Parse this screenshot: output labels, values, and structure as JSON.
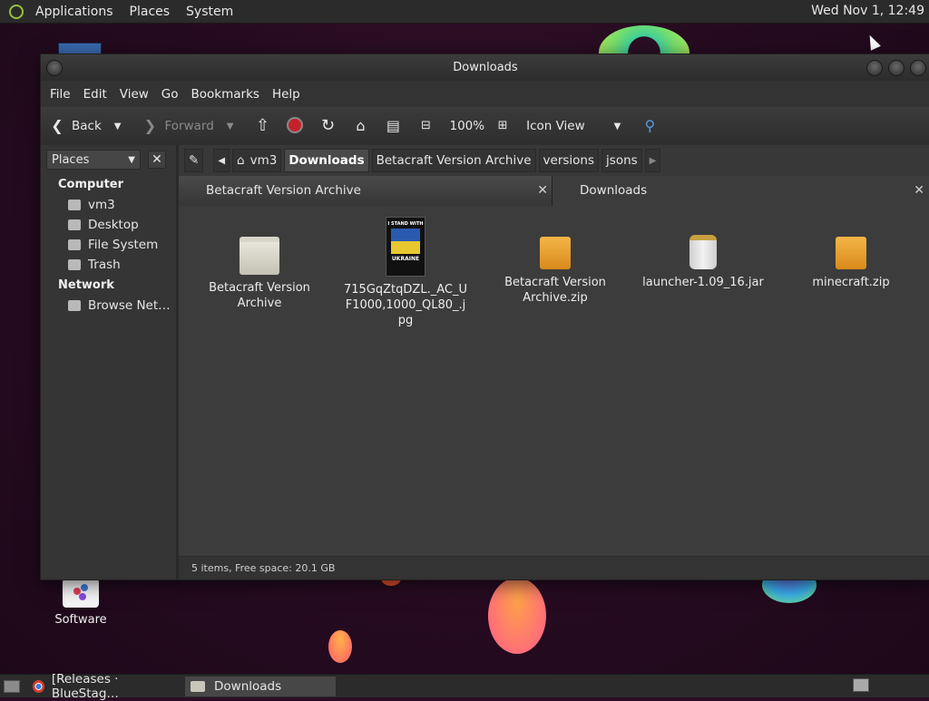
{
  "top_panel": {
    "menus": [
      "Applications",
      "Places",
      "System"
    ],
    "clock": "Wed Nov 1, 12:49"
  },
  "desktop": {
    "software_label": "Software"
  },
  "window": {
    "title": "Downloads",
    "menubar": [
      "File",
      "Edit",
      "View",
      "Go",
      "Bookmarks",
      "Help"
    ],
    "toolbar": {
      "back": "Back",
      "forward": "Forward",
      "zoom": "100%",
      "view_mode": "Icon View"
    },
    "sidebar": {
      "selector": "Places",
      "groups": [
        {
          "title": "Computer",
          "items": [
            "vm3",
            "Desktop",
            "File System",
            "Trash"
          ]
        },
        {
          "title": "Network",
          "items": [
            "Browse Net…"
          ]
        }
      ]
    },
    "pathbar": [
      "vm3",
      "Downloads",
      "Betacraft Version Archive",
      "versions",
      "jsons"
    ],
    "tabs": [
      {
        "label": "Betacraft Version Archive"
      },
      {
        "label": "Downloads"
      }
    ],
    "files": [
      {
        "name": "Betacraft Version Archive",
        "type": "folder"
      },
      {
        "name": "715GqZtqDZL._AC_UF1000,1000_QL80_.jpg",
        "type": "image",
        "thumb_text_1": "I STAND WITH",
        "thumb_text_2": "UKRAINE"
      },
      {
        "name": "Betacraft Version Archive.zip",
        "type": "archive"
      },
      {
        "name": "launcher-1.09_16.jar",
        "type": "jar"
      },
      {
        "name": "minecraft.zip",
        "type": "archive"
      }
    ],
    "status": "5 items, Free space: 20.1 GB"
  },
  "taskbar": {
    "tasks": [
      "[Releases · BlueStag…",
      "Downloads"
    ]
  }
}
